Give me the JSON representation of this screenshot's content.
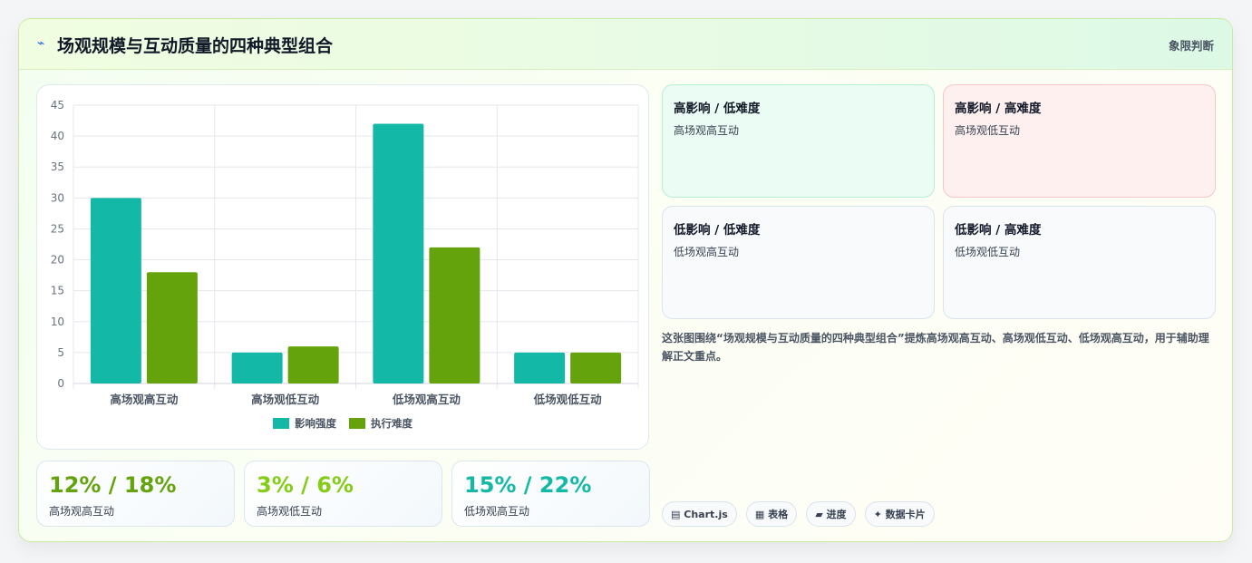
{
  "header": {
    "icon": "⌁",
    "icon_name": "pulse-icon",
    "title": "场观规模与互动质量的四种典型组合",
    "tag": "象限判断"
  },
  "chart_data": {
    "type": "bar",
    "categories": [
      "高场观高互动",
      "高场观低互动",
      "低场观高互动",
      "低场观低互动"
    ],
    "series": [
      {
        "name": "影响强度",
        "values": [
          30,
          5,
          42,
          5
        ],
        "color": "#14b8a6"
      },
      {
        "name": "执行难度",
        "values": [
          18,
          6,
          22,
          5
        ],
        "color": "#65a30d"
      }
    ],
    "ylim": [
      0,
      45
    ],
    "yticks": [
      0,
      5,
      10,
      15,
      20,
      25,
      30,
      35,
      40,
      45
    ],
    "grid": true,
    "legend": "bottom"
  },
  "stats": [
    {
      "value": "12% / 18%",
      "label": "高场观高互动",
      "color": "#65a30d"
    },
    {
      "value": "3% / 6%",
      "label": "高场观低互动",
      "color": "#84cc16"
    },
    {
      "value": "15% / 22%",
      "label": "低场观高互动",
      "color": "#14b8a6"
    }
  ],
  "quadrants": [
    {
      "title": "高影响 / 低难度",
      "subtitle": "高场观高互动"
    },
    {
      "title": "高影响 / 高难度",
      "subtitle": "高场观低互动"
    },
    {
      "title": "低影响 / 低难度",
      "subtitle": "低场观高互动"
    },
    {
      "title": "低影响 / 高难度",
      "subtitle": "低场观低互动"
    }
  ],
  "description": "这张图围绕“场观规模与互动质量的四种典型组合”提炼高场观高互动、高场观低互动、低场观高互动，用于辅助理解正文重点。",
  "chips": [
    {
      "icon": "▤",
      "label": "Chart.js"
    },
    {
      "icon": "▦",
      "label": "表格"
    },
    {
      "icon": "▰",
      "label": "进度"
    },
    {
      "icon": "✦",
      "label": "数据卡片"
    }
  ]
}
